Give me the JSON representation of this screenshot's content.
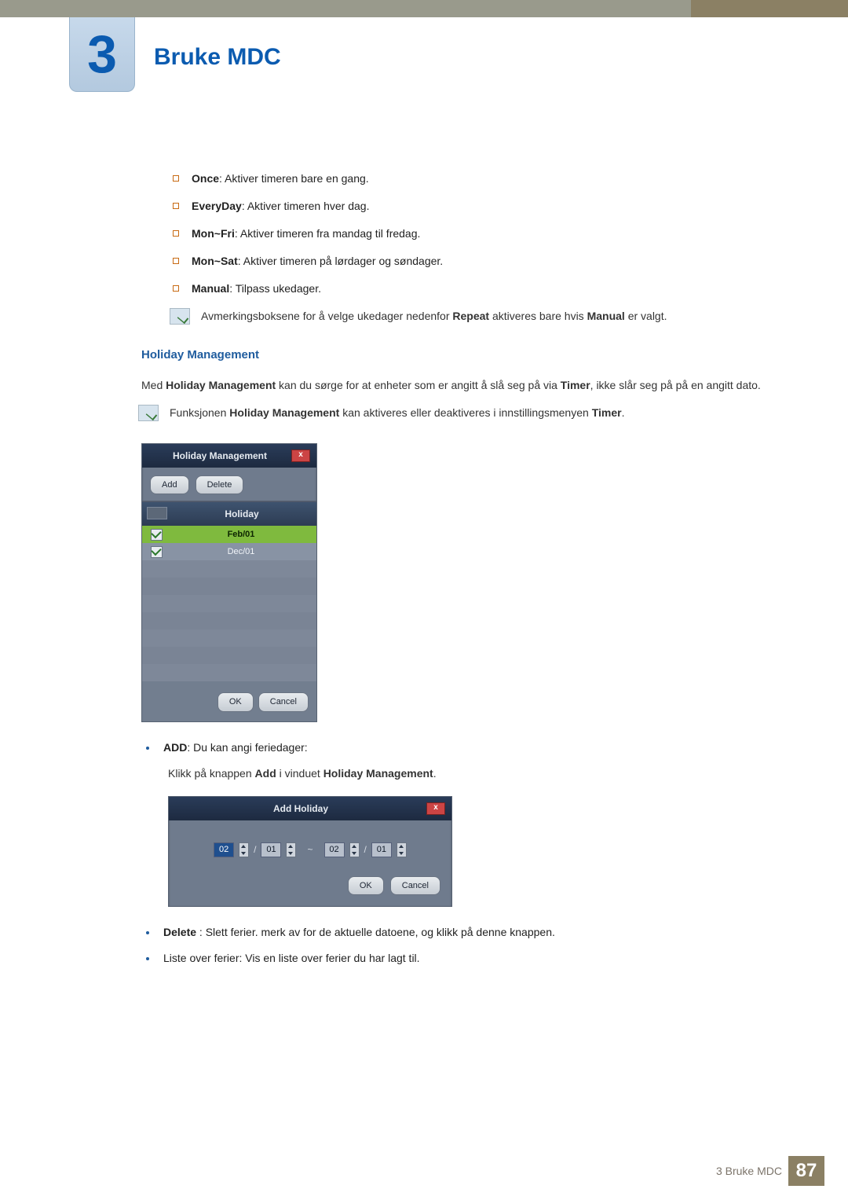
{
  "chapter": {
    "number": "3",
    "title": "Bruke MDC"
  },
  "timer_options": [
    {
      "label": "Once",
      "desc": ": Aktiver timeren bare en gang."
    },
    {
      "label": "EveryDay",
      "desc": ": Aktiver timeren hver dag."
    },
    {
      "label": "Mon~Fri",
      "desc": ": Aktiver timeren fra mandag til fredag."
    },
    {
      "label": "Mon~Sat",
      "desc": ": Aktiver timeren på lørdager og søndager."
    },
    {
      "label": "Manual",
      "desc": ": Tilpass ukedager."
    }
  ],
  "notes": {
    "repeat_note_pre": "Avmerkingsboksene for å velge ukedager nedenfor ",
    "repeat_note_bold1": "Repeat",
    "repeat_note_mid": " aktiveres bare hvis ",
    "repeat_note_bold2": "Manual",
    "repeat_note_post": " er valgt.",
    "hm_note_pre": "Funksjonen ",
    "hm_note_bold1": "Holiday Management",
    "hm_note_mid": " kan aktiveres eller deaktiveres i innstillingsmenyen ",
    "hm_note_bold2": "Timer",
    "hm_note_post": "."
  },
  "hm_section": {
    "heading": "Holiday Management",
    "para_pre": "Med ",
    "para_bold1": "Holiday Management",
    "para_mid": " kan du sørge for at enheter som er angitt å slå seg på via ",
    "para_bold2": "Timer",
    "para_post": ", ikke slår seg på på en angitt dato."
  },
  "hm_dialog": {
    "title": "Holiday Management",
    "close": "x",
    "add": "Add",
    "delete": "Delete",
    "header": "Holiday",
    "rows": [
      {
        "value": "Feb/01",
        "selected": true
      },
      {
        "value": "Dec/01",
        "selected": false
      }
    ],
    "ok": "OK",
    "cancel": "Cancel"
  },
  "actions": {
    "add_label": "ADD",
    "add_desc": ": Du kan angi feriedager:",
    "add_sub_pre": "Klikk på knappen ",
    "add_sub_bold1": "Add",
    "add_sub_mid": " i vinduet ",
    "add_sub_bold2": "Holiday Management",
    "add_sub_post": ".",
    "delete_label": "Delete",
    "delete_desc": " : Slett ferier. merk av for de aktuelle datoene, og klikk på denne knappen.",
    "list_desc": "Liste over ferier: Vis en liste over ferier du har lagt til."
  },
  "ah_dialog": {
    "title": "Add Holiday",
    "close": "x",
    "from_month": "02",
    "from_day": "01",
    "tilde": "~",
    "to_month": "02",
    "to_day": "01",
    "slash": "/",
    "ok": "OK",
    "cancel": "Cancel"
  },
  "footer": {
    "text": "3 Bruke MDC",
    "page": "87"
  }
}
